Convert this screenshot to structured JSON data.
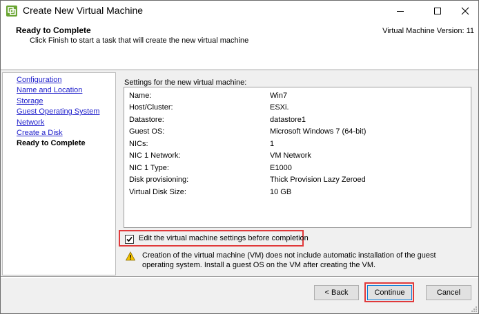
{
  "window": {
    "title": "Create New Virtual Machine"
  },
  "header": {
    "title": "Ready to Complete",
    "subtitle": "Click Finish to start a task that will create the new virtual machine",
    "version": "Virtual Machine Version: 11"
  },
  "nav": {
    "items": [
      {
        "label": "Configuration",
        "current": false
      },
      {
        "label": "Name and Location",
        "current": false
      },
      {
        "label": "Storage",
        "current": false
      },
      {
        "label": "Guest Operating System",
        "current": false
      },
      {
        "label": "Network",
        "current": false
      },
      {
        "label": "Create a Disk",
        "current": false
      },
      {
        "label": "Ready to Complete",
        "current": true
      }
    ]
  },
  "settings": {
    "heading": "Settings for the new virtual machine:",
    "rows": [
      {
        "key": "Name:",
        "value": "Win7"
      },
      {
        "key": "Host/Cluster:",
        "value": "ESXi."
      },
      {
        "key": "Datastore:",
        "value": "datastore1"
      },
      {
        "key": "Guest OS:",
        "value": "Microsoft Windows 7 (64-bit)"
      },
      {
        "key": "NICs:",
        "value": "1"
      },
      {
        "key": "NIC 1 Network:",
        "value": "VM Network"
      },
      {
        "key": "NIC 1 Type:",
        "value": "E1000"
      },
      {
        "key": "Disk provisioning:",
        "value": "Thick Provision Lazy Zeroed"
      },
      {
        "key": "Virtual Disk Size:",
        "value": "10 GB"
      }
    ]
  },
  "edit_checkbox": {
    "label": "Edit the virtual machine settings before completion",
    "checked": true
  },
  "warning": {
    "icon": "warning-icon",
    "text": "Creation of the virtual machine (VM) does not include automatic installation of the guest operating system. Install a guest OS on the VM after creating the VM."
  },
  "buttons": {
    "back": "< Back",
    "continue": "Continue",
    "cancel": "Cancel"
  },
  "colors": {
    "highlight": "#e0393a",
    "link": "#2222cc",
    "dialog_bg": "#f0f0f0",
    "vmware_green": "#6aa533"
  }
}
